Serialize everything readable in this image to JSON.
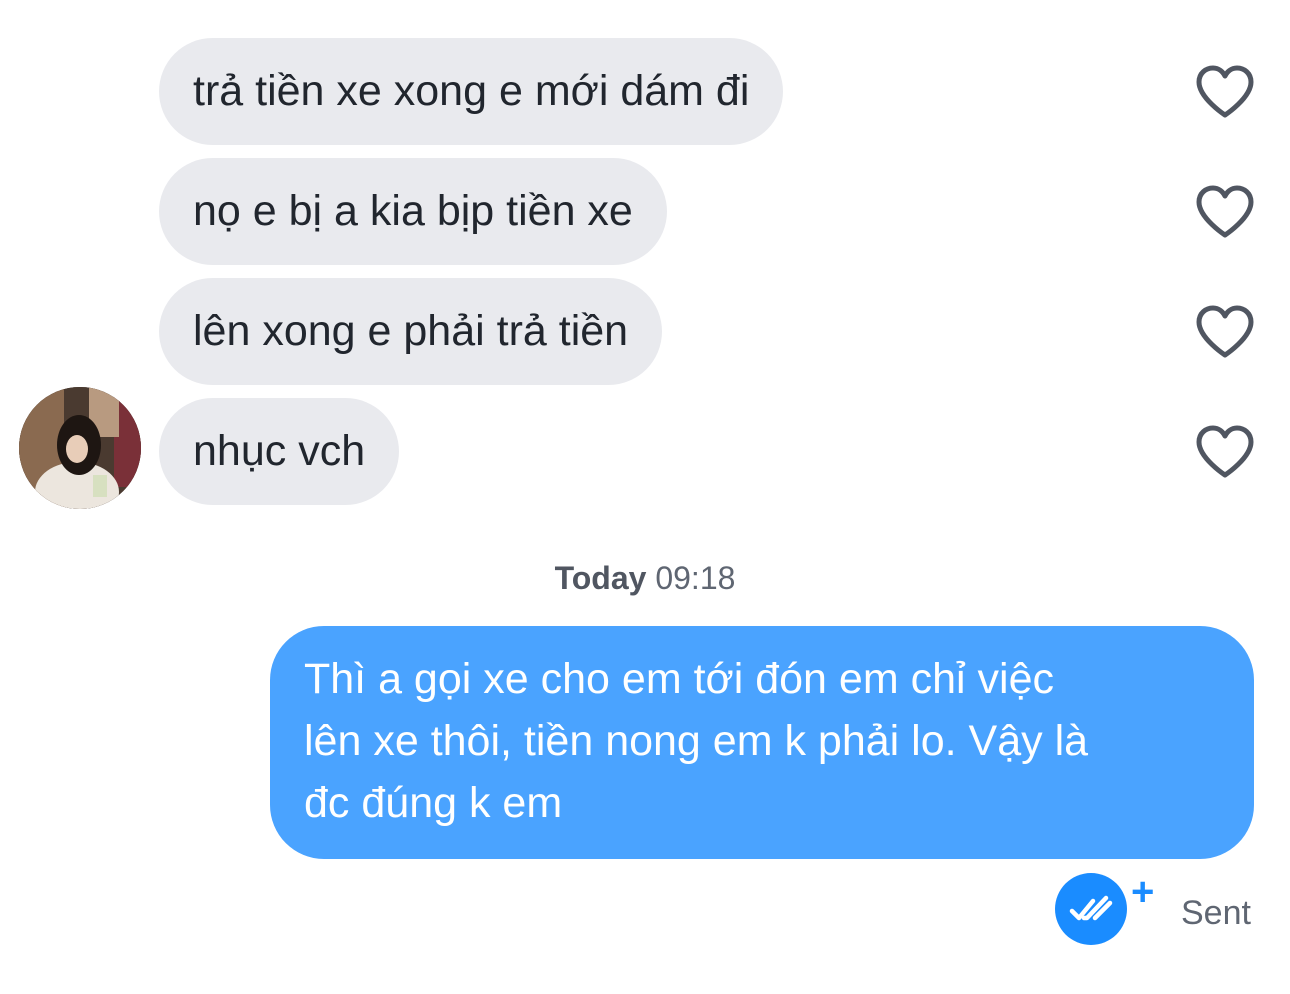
{
  "incoming_messages": [
    {
      "text": "trả tiền xe xong e mới dám đi"
    },
    {
      "text": "nọ e bị a kia bịp tiền xe"
    },
    {
      "text": "lên xong e phải trả tiền"
    },
    {
      "text": "nhục vch"
    }
  ],
  "timestamp": {
    "day": "Today",
    "time": "09:18"
  },
  "outgoing_message": {
    "lines": [
      "Thì a gọi xe cho em tới đón em chỉ việc",
      "lên xe thôi, tiền nong em k phải lo. Vậy là",
      "đc đúng k em"
    ]
  },
  "status": {
    "label": "Sent",
    "plus": "+"
  },
  "colors": {
    "incoming_bubble": "#e9eaee",
    "outgoing_bubble": "#4aa3ff",
    "accent": "#1a8cff",
    "heart_outline": "#505661"
  }
}
